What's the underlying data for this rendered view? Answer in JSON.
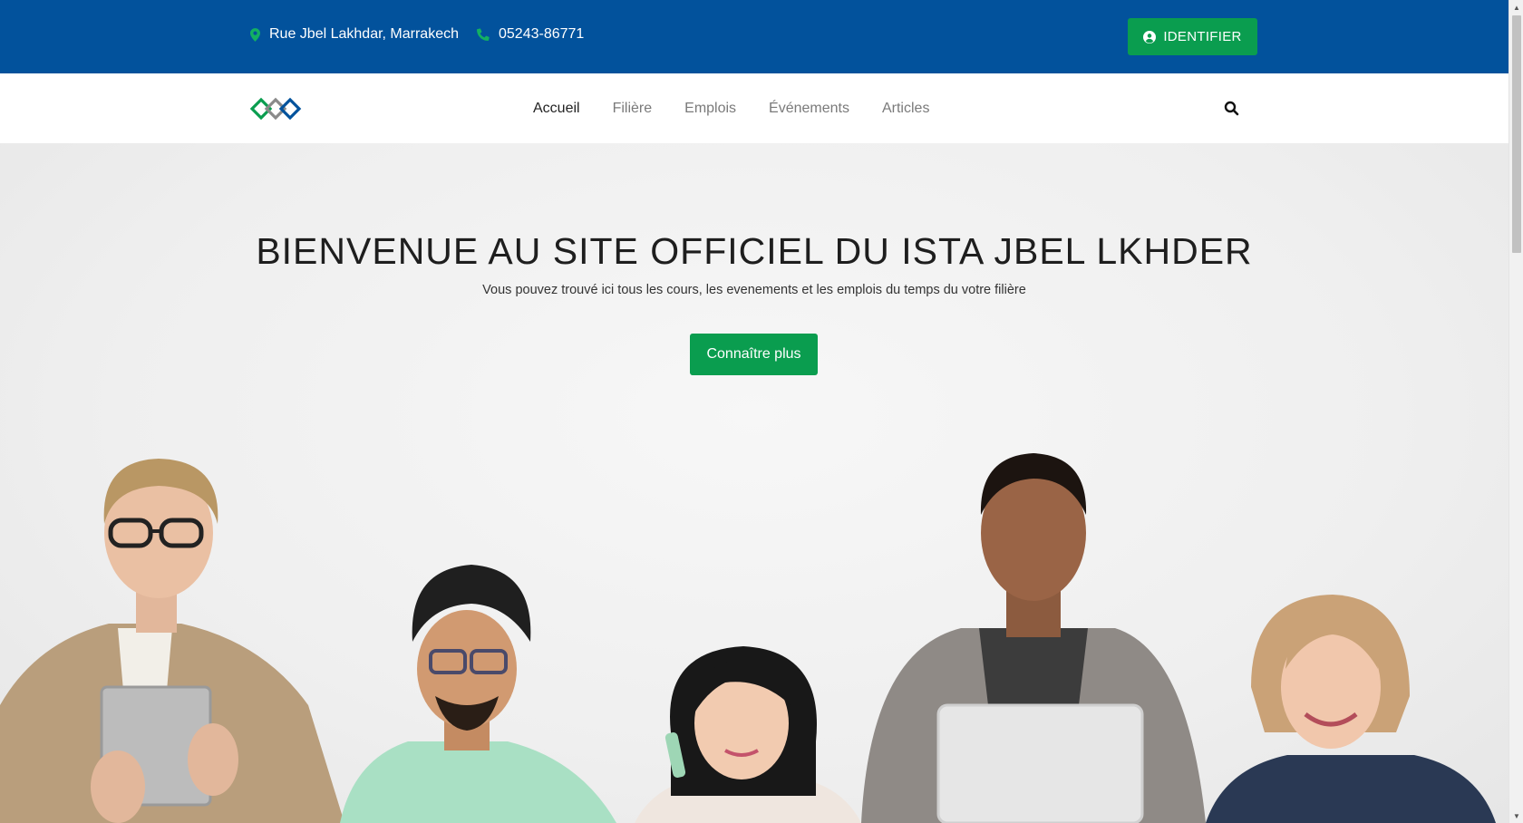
{
  "topbar": {
    "address": "Rue Jbel Lakhdar, Marrakech",
    "phone": "05243-86771",
    "login_label": "IDENTIFIER",
    "background": "#02529c",
    "accent": "#0a9d4f"
  },
  "navbar": {
    "items": [
      {
        "label": "Accueil",
        "active": true
      },
      {
        "label": "Filière"
      },
      {
        "label": "Emplois"
      },
      {
        "label": "Événements"
      },
      {
        "label": "Articles"
      }
    ],
    "search_icon": "search-icon",
    "logo_icon": "diamond-chain-logo"
  },
  "hero": {
    "title": "BIENVENUE AU SITE OFFICIEL DU ISTA JBEL LKHDER",
    "subtitle": "Vous pouvez trouvé ici tous les cours, les evenements et les emplois du temps du votre filière",
    "cta_label": "Connaître plus",
    "image": "people-using-devices-photo"
  },
  "icons": {
    "address": "map-pin-icon",
    "phone": "phone-icon",
    "login": "user-circle-icon"
  }
}
